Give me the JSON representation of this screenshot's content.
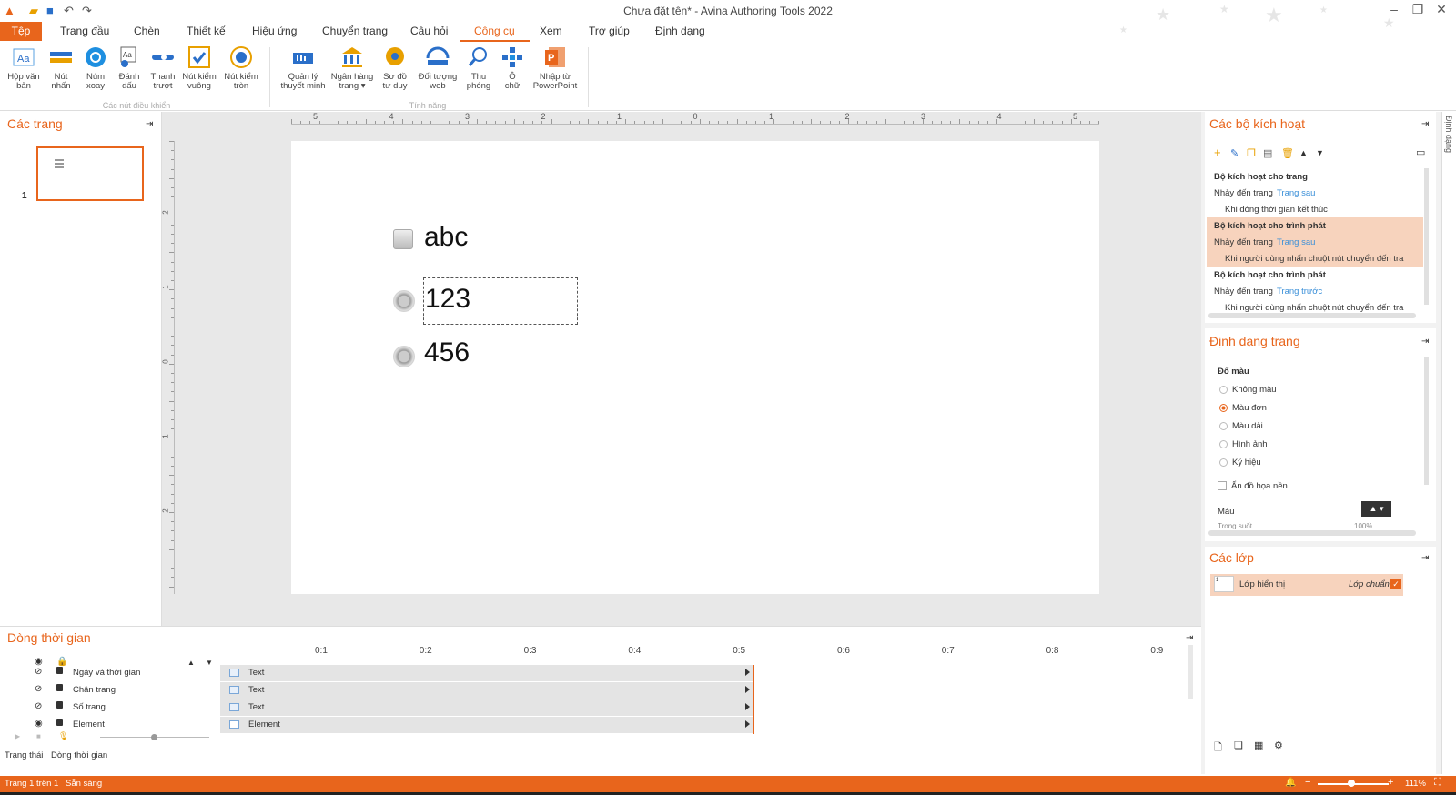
{
  "app": {
    "title": "Chưa đặt tên* - Avina Authoring Tools 2022"
  },
  "menu": {
    "file": "Tệp",
    "tabs": [
      "Trang đầu",
      "Chèn",
      "Thiết kế",
      "Hiệu ứng",
      "Chuyển trang",
      "Câu hỏi",
      "Công cụ",
      "Xem",
      "Trợ giúp",
      "Định dạng"
    ],
    "active": "Công cụ"
  },
  "ribbon": {
    "controls": [
      {
        "l1": "Hộp văn",
        "l2": "bản",
        "icon": "textbox-icon"
      },
      {
        "l1": "Nút",
        "l2": "nhấn",
        "icon": "button-icon"
      },
      {
        "l1": "Núm",
        "l2": "xoay",
        "icon": "dial-icon"
      },
      {
        "l1": "Đánh",
        "l2": "dấu",
        "icon": "marker-icon"
      },
      {
        "l1": "Thanh",
        "l2": "trượt",
        "icon": "slider-icon"
      },
      {
        "l1": "Nút kiểm",
        "l2": "vuông",
        "icon": "checkbox-icon"
      },
      {
        "l1": "Nút kiểm",
        "l2": "tròn",
        "icon": "radio-icon"
      }
    ],
    "controls_group": "Các nút điều khiển",
    "features": [
      {
        "l1": "Quản lý",
        "l2": "thuyết minh",
        "icon": "narration-icon"
      },
      {
        "l1": "Ngân hàng",
        "l2": "trang ▾",
        "icon": "page-bank-icon"
      },
      {
        "l1": "Sơ đồ",
        "l2": "tư duy",
        "icon": "mindmap-icon"
      },
      {
        "l1": "Đối tượng",
        "l2": "web",
        "icon": "web-object-icon"
      },
      {
        "l1": "Thu",
        "l2": "phóng",
        "icon": "zoom-icon"
      },
      {
        "l1": "Ô",
        "l2": "chữ",
        "icon": "crossword-icon"
      },
      {
        "l1": "Nhập từ",
        "l2": "PowerPoint",
        "icon": "powerpoint-icon"
      }
    ],
    "features_group": "Tính năng"
  },
  "pages_panel": {
    "title": "Các trang",
    "page_number": "1"
  },
  "ruler": {
    "h": [
      "5",
      "4",
      "3",
      "2",
      "1",
      "0",
      "1",
      "2",
      "3",
      "4",
      "5"
    ],
    "v": [
      "2",
      "1",
      "0",
      "1",
      "2"
    ]
  },
  "slide": {
    "items": [
      "abc",
      "123",
      "456"
    ]
  },
  "triggers_panel": {
    "title": "Các bộ kích hoạt",
    "rows": [
      {
        "text": "Bộ kích hoạt cho trang",
        "bold": true
      },
      {
        "text": "Nhảy đến trang",
        "link": "Trang sau"
      },
      {
        "text": "Khi dòng thời gian kết thúc",
        "indent": true
      },
      {
        "text": "Bộ kích hoạt cho trình phát",
        "bold": true,
        "hl": true
      },
      {
        "text": "Nhảy đến trang",
        "link": "Trang sau",
        "hl": true
      },
      {
        "text": "Khi người dùng nhấn chuột nút chuyển đến tra",
        "indent": true,
        "hl": true
      },
      {
        "text": "Bộ kích hoạt cho trình phát",
        "bold": true
      },
      {
        "text": "Nhảy đến trang",
        "link": "Trang trước"
      },
      {
        "text": "Khi người dùng nhấn chuột nút chuyển đến tra",
        "indent": true
      }
    ]
  },
  "format_panel": {
    "title": "Định dạng trang",
    "fill_label": "Đổ màu",
    "options": [
      "Không màu",
      "Màu đơn",
      "Màu dải",
      "Hình ảnh",
      "Ký hiệu"
    ],
    "selected": "Màu đơn",
    "hide_bg": "Ẩn đồ họa nền",
    "color_label": "Màu",
    "transparency_label": "Trong suốt",
    "transparency_value": "100%"
  },
  "layers_panel": {
    "title": "Các lớp",
    "layer_name": "Lớp hiển thị",
    "layer_std": "Lớp chuẩn",
    "thumb_num": "1"
  },
  "right_strip": {
    "label": "Định dạng"
  },
  "timeline": {
    "title": "Dòng thời gian",
    "ticks": [
      "0:1",
      "0:2",
      "0:3",
      "0:4",
      "0:5",
      "0:6",
      "0:7",
      "0:8",
      "0:9"
    ],
    "rows": [
      {
        "label": "Ngày và thời gian",
        "bar": "Text"
      },
      {
        "label": "Chân trang",
        "bar": "Text"
      },
      {
        "label": "Số trang",
        "bar": "Text"
      },
      {
        "label": "Element",
        "bar": "Element"
      }
    ],
    "tabs": [
      "Trạng thái",
      "Dòng thời gian"
    ]
  },
  "status": {
    "page": "Trang 1 trên 1",
    "ready": "Sẵn sàng",
    "zoom": "111%"
  },
  "colors": {
    "accent": "#e8651c",
    "highlight": "#f7d3bd",
    "link": "#3a8fd8"
  }
}
